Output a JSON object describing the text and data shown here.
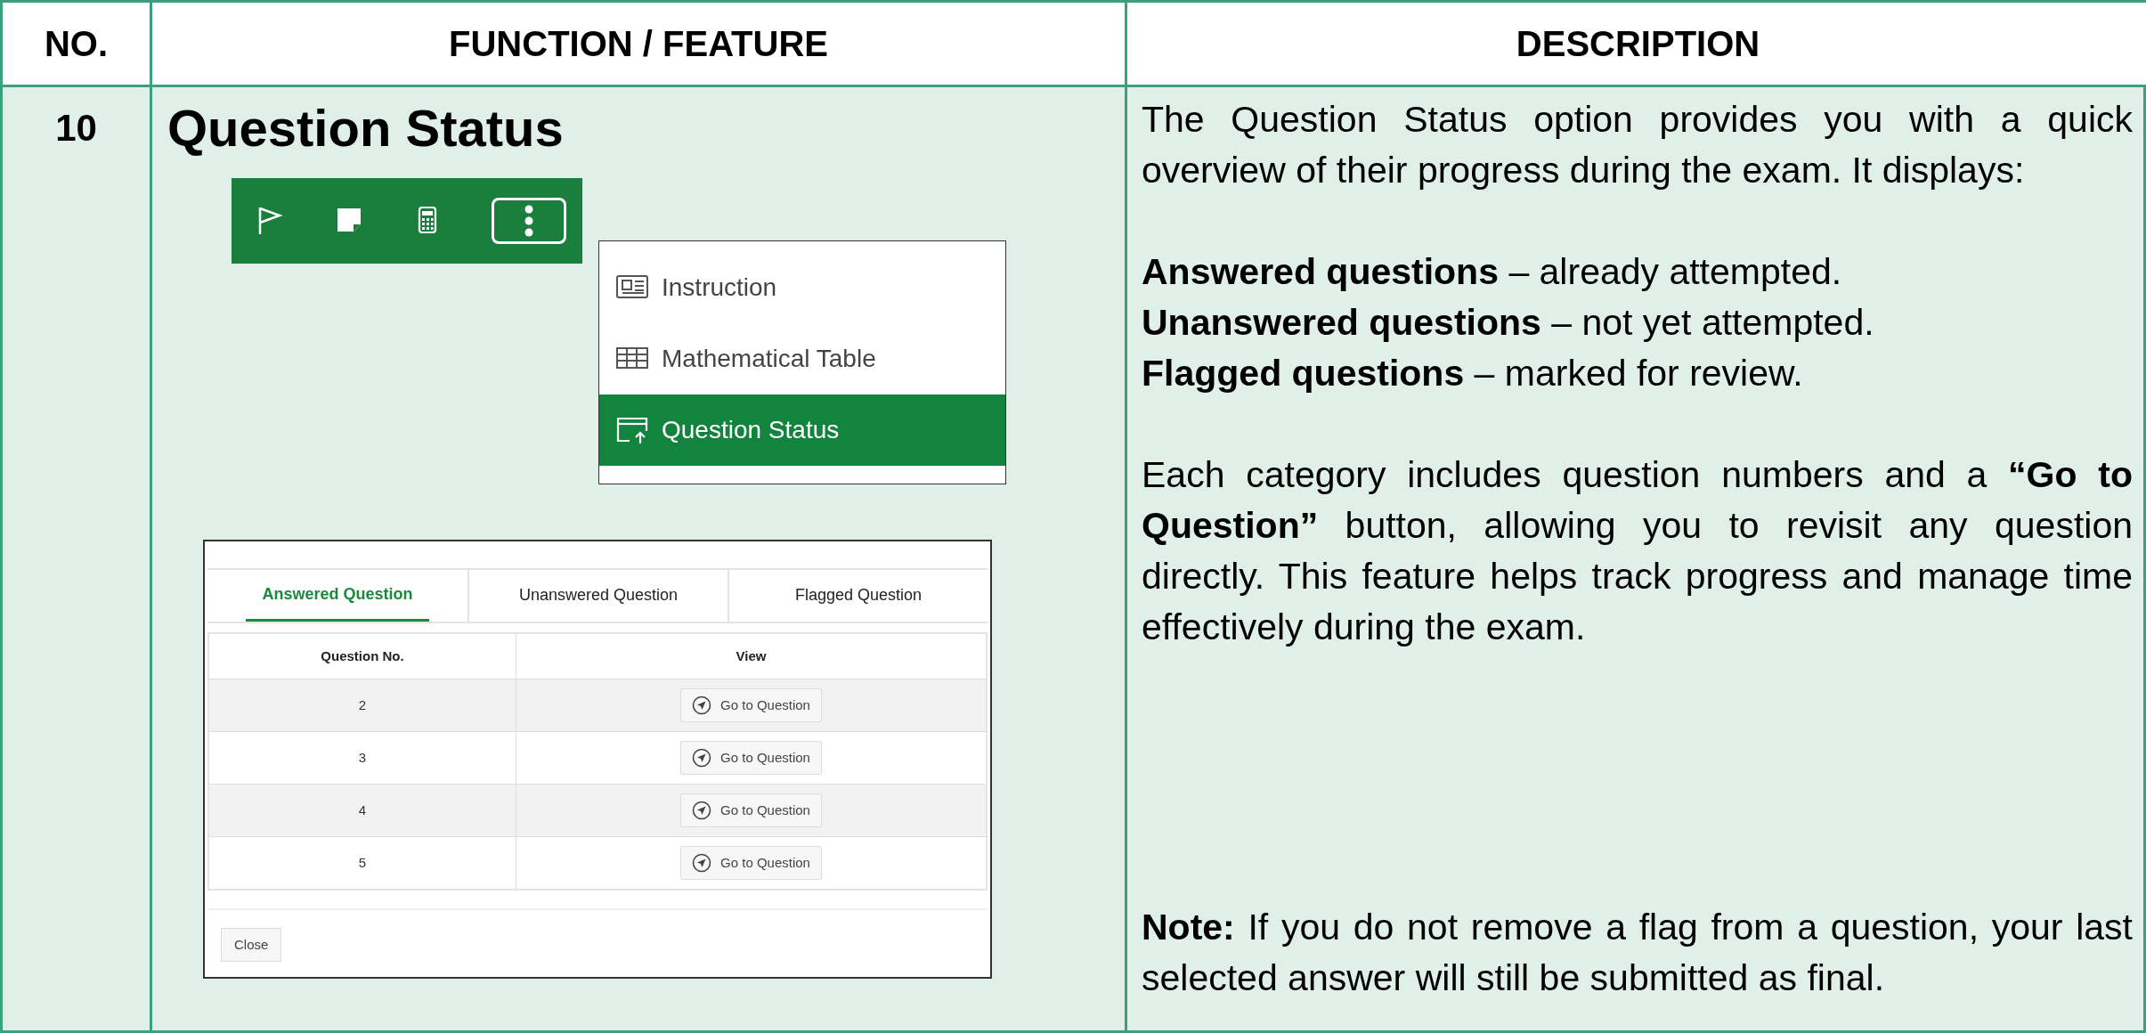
{
  "table": {
    "columns": [
      "NO.",
      "FUNCTION / FEATURE",
      "DESCRIPTION"
    ],
    "rows": [
      {
        "no": "10",
        "feature": {
          "title": "Question Status",
          "toolbar": [
            {
              "kind": "flag"
            },
            {
              "kind": "note"
            },
            {
              "kind": "calculator"
            },
            {
              "kind": "more"
            }
          ],
          "menu": [
            {
              "kind": "instruction",
              "label": "Instruction",
              "selected": false
            },
            {
              "kind": "table",
              "label": "Mathematical Table",
              "selected": false
            },
            {
              "kind": "status",
              "label": "Question Status",
              "selected": true
            }
          ],
          "dialog": {
            "tabs": [
              {
                "label": "Answered Question",
                "selected": true
              },
              {
                "label": "Unanswered Question",
                "selected": false
              },
              {
                "label": "Flagged Question",
                "selected": false
              }
            ],
            "columns": [
              "Question No.",
              "View"
            ],
            "rows": [
              {
                "number": "2",
                "button": "Go to Question"
              },
              {
                "number": "3",
                "button": "Go to Question"
              },
              {
                "number": "4",
                "button": "Go to Question"
              },
              {
                "number": "5",
                "button": "Go to Question"
              }
            ],
            "close": "Close"
          }
        },
        "description": {
          "paragraphs": [
            [
              "The Question Status option provides you with a quick overview of their progress during the exam. It displays:"
            ],
            [
              "**Answered questions** – already attempted.",
              "**Unanswered questions** – not yet attempted.",
              "**Flagged questions** – marked for review."
            ],
            [
              "Each category includes question numbers and a **“Go to Question”** button, allowing you to revisit any question directly. This feature helps track progress and manage time effectively during the exam."
            ]
          ],
          "note": "**Note:** If you do not remove a flag from a question, your last selected answer will still be submitted as final."
        }
      }
    ]
  }
}
